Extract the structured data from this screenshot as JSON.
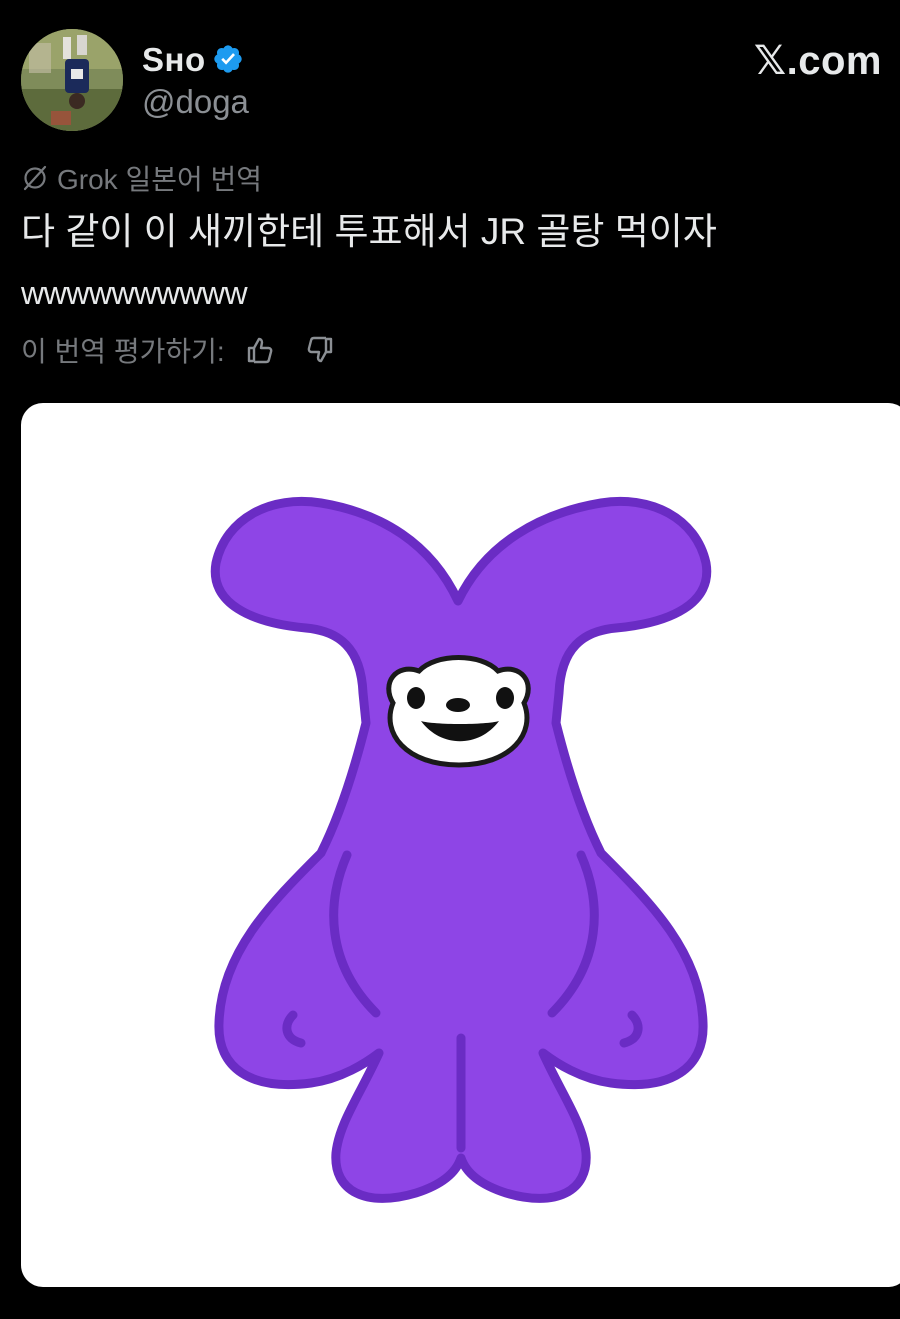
{
  "tweet": {
    "author": {
      "display_name": "Sʜᴏ",
      "handle": "@doga",
      "verified": true,
      "avatar_icon": "profile-photo"
    },
    "brand": "𝕏.com",
    "translation": {
      "label": "Grok 일본어 번역",
      "icon": "translate-off-icon"
    },
    "text_line1": "다 같이 이 새끼한테 투표해서 JR 골탕 먹이자",
    "text_line2": "wwwwwwwwww",
    "rate": {
      "label": "이 번역 평가하기:",
      "up_icon": "thumbs-up-icon",
      "down_icon": "thumbs-down-icon"
    },
    "media": {
      "kind": "image",
      "subject_icon": "purple-rabbit-character"
    }
  },
  "colors": {
    "background": "#000000",
    "text_primary": "#e7e9ea",
    "text_secondary": "#8b8f94",
    "verified_blue": "#1d9bf0",
    "character_fill": "#8e45e6",
    "character_outline": "#6a2cc4"
  }
}
